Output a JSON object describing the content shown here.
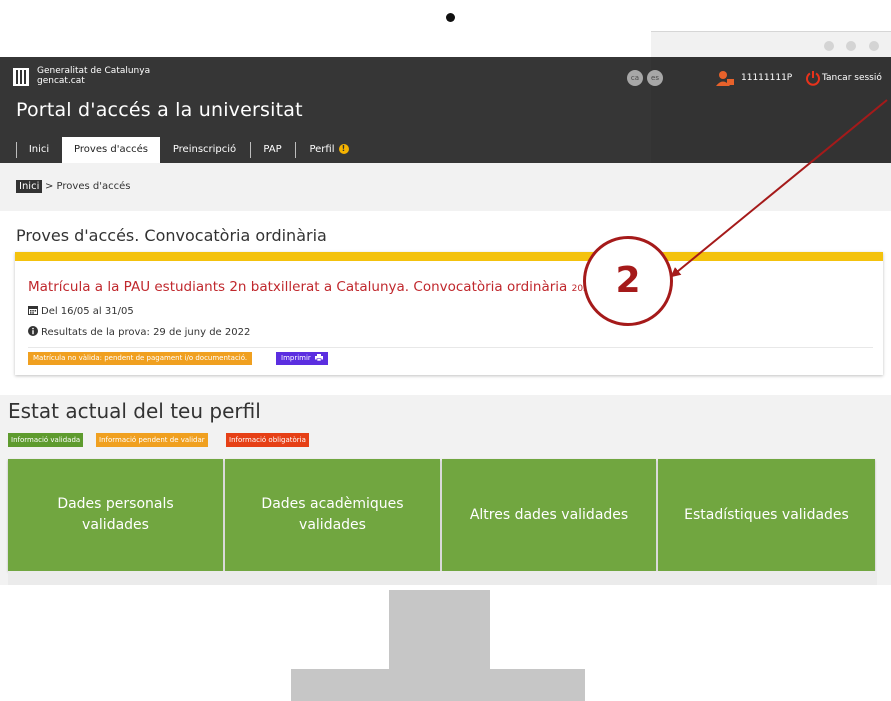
{
  "header": {
    "logo_line1": "Generalitat de Catalunya",
    "logo_line2": "gencat.cat",
    "portal_title": "Portal d'accés a la universitat",
    "lang_ca": "ca",
    "lang_es": "es",
    "user_id": "11111111P",
    "logout_label": "Tancar sessió"
  },
  "nav": {
    "tabs": [
      {
        "label": "Inici"
      },
      {
        "label": "Proves d'accés",
        "active": true
      },
      {
        "label": "Preinscripció"
      },
      {
        "label": "PAP"
      },
      {
        "label": "Perfil"
      }
    ],
    "perfil_alert": "!"
  },
  "breadcrumb": {
    "home": "Inici",
    "current": "> Proves d'accés"
  },
  "section": {
    "title": "Proves d'accés. Convocatòria ordinària"
  },
  "card": {
    "title": "Matrícula a la PAU estudiants 2n batxillerat a Catalunya. Convocatòria ordinària",
    "year": "2022",
    "dates": "Del 16/05 al 31/05",
    "results_label": "Resultats de la prova:",
    "results_date": "29 de juny de 2022",
    "status_badge": "Matrícula no vàlida: pendent de pagament i/o documentació.",
    "print_label": "Imprimir"
  },
  "profile": {
    "title": "Estat actual del teu perfil",
    "legend": {
      "valid": "Informació validada",
      "pending": "Informació pendent de validar",
      "required": "Informació obligatòria"
    },
    "tiles": [
      {
        "label": "Dades personals validades"
      },
      {
        "label": "Dades acadèmiques validades"
      },
      {
        "label": "Altres dades validades"
      },
      {
        "label": "Estadístiques validades"
      }
    ]
  },
  "annotation": {
    "step": "2"
  },
  "colors": {
    "header_bg": "#333333",
    "card_accent": "#f4c20d",
    "card_title": "#c0282d",
    "status_orange": "#f0a020",
    "print_purple": "#5b2ee0",
    "tile_green": "#71a640",
    "legend_green": "#5e9b2e",
    "legend_red": "#e64016",
    "annotation_red": "#a51a1a"
  }
}
